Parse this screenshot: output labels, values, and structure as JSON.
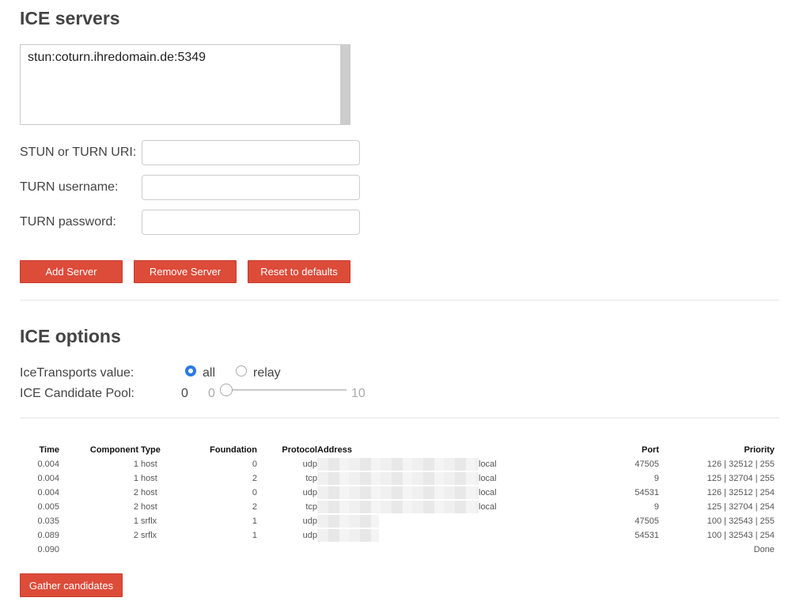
{
  "servers_section": {
    "title": "ICE servers",
    "server_list": [
      "stun:coturn.ihredomain.de:5349"
    ]
  },
  "form": {
    "uri_label": "STUN or TURN URI:",
    "uri_value": "",
    "username_label": "TURN username:",
    "username_value": "",
    "password_label": "TURN password:",
    "password_value": ""
  },
  "buttons": {
    "add": "Add Server",
    "remove": "Remove Server",
    "reset": "Reset to defaults",
    "gather": "Gather candidates"
  },
  "options_section": {
    "title": "ICE options",
    "transports_label": "IceTransports value:",
    "transport_all": "all",
    "transport_relay": "relay",
    "transport_selected": "all",
    "pool_label": "ICE Candidate Pool:",
    "pool_value": "0",
    "pool_min": "0",
    "pool_max": "10"
  },
  "candidates": {
    "headers": {
      "time": "Time",
      "component": "Component",
      "type": "Type",
      "foundation": "Foundation",
      "protocol": "Protocol",
      "address": "Address",
      "port": "Port",
      "priority": "Priority"
    },
    "rows": [
      {
        "time": "0.004",
        "component": "1",
        "type": "host",
        "foundation": "0",
        "protocol": "udp",
        "address_suffix": "local",
        "port": "47505",
        "priority": "126 | 32512 | 255"
      },
      {
        "time": "0.004",
        "component": "1",
        "type": "host",
        "foundation": "2",
        "protocol": "tcp",
        "address_suffix": "local",
        "port": "9",
        "priority": "125 | 32704 | 255"
      },
      {
        "time": "0.004",
        "component": "2",
        "type": "host",
        "foundation": "0",
        "protocol": "udp",
        "address_suffix": "local",
        "port": "54531",
        "priority": "126 | 32512 | 254"
      },
      {
        "time": "0.005",
        "component": "2",
        "type": "host",
        "foundation": "2",
        "protocol": "tcp",
        "address_suffix": "local",
        "port": "9",
        "priority": "125 | 32704 | 254"
      },
      {
        "time": "0.035",
        "component": "1",
        "type": "srflx",
        "foundation": "1",
        "protocol": "udp",
        "address_suffix": "",
        "port": "47505",
        "priority": "100 | 32543 | 255"
      },
      {
        "time": "0.089",
        "component": "2",
        "type": "srflx",
        "foundation": "1",
        "protocol": "udp",
        "address_suffix": "",
        "port": "54531",
        "priority": "100 | 32543 | 254"
      },
      {
        "time": "0.090",
        "component": "",
        "type": "",
        "foundation": "",
        "protocol": "",
        "address_suffix": "",
        "port": "",
        "priority": "Done"
      }
    ]
  }
}
